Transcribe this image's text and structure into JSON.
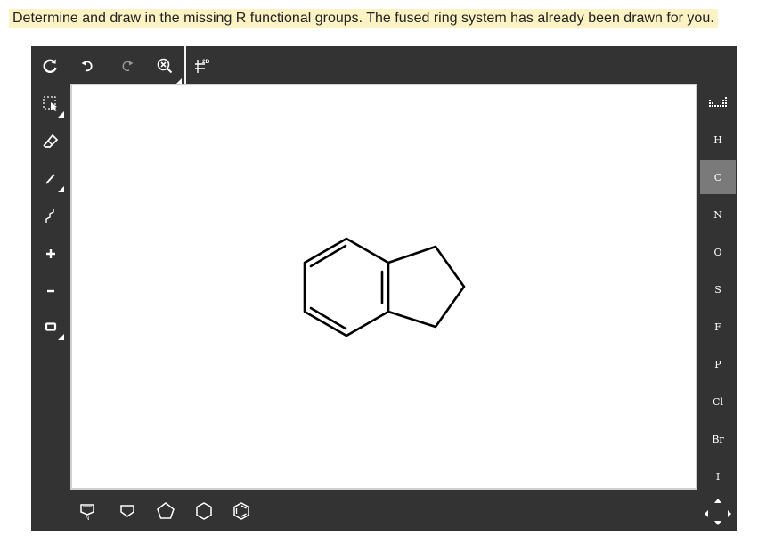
{
  "instruction": "Determine and draw in the missing R functional groups. The fused ring system has already been drawn for you.",
  "top_toolbar": {
    "clean_label": "2D"
  },
  "element_buttons": [
    {
      "label": "H",
      "name": "element-h-button"
    },
    {
      "label": "C",
      "name": "element-c-button",
      "selected": true
    },
    {
      "label": "N",
      "name": "element-n-button"
    },
    {
      "label": "O",
      "name": "element-o-button"
    },
    {
      "label": "S",
      "name": "element-s-button"
    },
    {
      "label": "F",
      "name": "element-f-button"
    },
    {
      "label": "P",
      "name": "element-p-button"
    },
    {
      "label": "Cl",
      "name": "element-cl-button"
    },
    {
      "label": "Br",
      "name": "element-br-button"
    },
    {
      "label": "I",
      "name": "element-i-button"
    }
  ],
  "bottom_toolbar": {
    "templates": [
      "pyrrole",
      "cyclobutane",
      "cyclopentane",
      "cyclohexane",
      "benzene"
    ]
  },
  "molecule": {
    "name": "indane",
    "selected_element": "C"
  },
  "colors": {
    "toolbar_bg": "#333333",
    "icon": "#ffffff",
    "selected_button": "#7a7a7a",
    "instruction_highlight": "#fbf3c4"
  }
}
